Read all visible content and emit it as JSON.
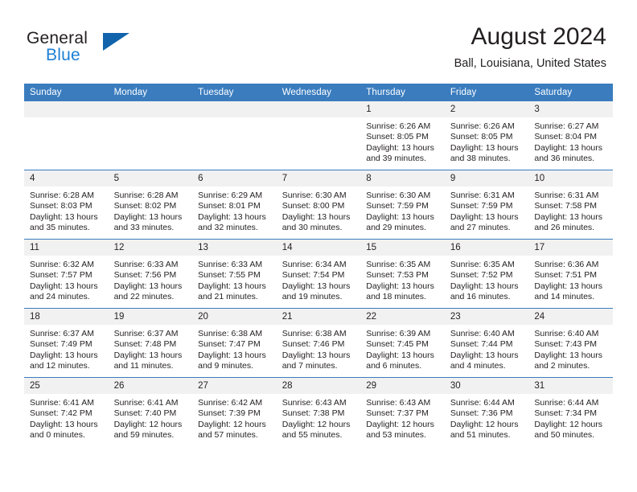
{
  "brand": {
    "name_top": "General",
    "name_bottom": "Blue",
    "triangle_color": "#1163ab",
    "blue_text_color": "#1b7fd4"
  },
  "header": {
    "title": "August 2024",
    "location": "Ball, Louisiana, United States"
  },
  "theme": {
    "header_blue": "#3a7cbe",
    "daynum_bg": "#f1f1f1",
    "text": "#231f20"
  },
  "calendar": {
    "weekday_headers": [
      "Sunday",
      "Monday",
      "Tuesday",
      "Wednesday",
      "Thursday",
      "Friday",
      "Saturday"
    ],
    "labels": {
      "sunrise": "Sunrise:",
      "sunset": "Sunset:",
      "daylight": "Daylight:"
    },
    "weeks": [
      [
        {
          "day": "",
          "blank": true
        },
        {
          "day": "",
          "blank": true
        },
        {
          "day": "",
          "blank": true
        },
        {
          "day": "",
          "blank": true
        },
        {
          "day": "1",
          "l1": "Sunrise: 6:26 AM",
          "l2": "Sunset: 8:05 PM",
          "l3": "Daylight: 13 hours",
          "l4": "and 39 minutes."
        },
        {
          "day": "2",
          "l1": "Sunrise: 6:26 AM",
          "l2": "Sunset: 8:05 PM",
          "l3": "Daylight: 13 hours",
          "l4": "and 38 minutes."
        },
        {
          "day": "3",
          "l1": "Sunrise: 6:27 AM",
          "l2": "Sunset: 8:04 PM",
          "l3": "Daylight: 13 hours",
          "l4": "and 36 minutes."
        }
      ],
      [
        {
          "day": "4",
          "l1": "Sunrise: 6:28 AM",
          "l2": "Sunset: 8:03 PM",
          "l3": "Daylight: 13 hours",
          "l4": "and 35 minutes."
        },
        {
          "day": "5",
          "l1": "Sunrise: 6:28 AM",
          "l2": "Sunset: 8:02 PM",
          "l3": "Daylight: 13 hours",
          "l4": "and 33 minutes."
        },
        {
          "day": "6",
          "l1": "Sunrise: 6:29 AM",
          "l2": "Sunset: 8:01 PM",
          "l3": "Daylight: 13 hours",
          "l4": "and 32 minutes."
        },
        {
          "day": "7",
          "l1": "Sunrise: 6:30 AM",
          "l2": "Sunset: 8:00 PM",
          "l3": "Daylight: 13 hours",
          "l4": "and 30 minutes."
        },
        {
          "day": "8",
          "l1": "Sunrise: 6:30 AM",
          "l2": "Sunset: 7:59 PM",
          "l3": "Daylight: 13 hours",
          "l4": "and 29 minutes."
        },
        {
          "day": "9",
          "l1": "Sunrise: 6:31 AM",
          "l2": "Sunset: 7:59 PM",
          "l3": "Daylight: 13 hours",
          "l4": "and 27 minutes."
        },
        {
          "day": "10",
          "l1": "Sunrise: 6:31 AM",
          "l2": "Sunset: 7:58 PM",
          "l3": "Daylight: 13 hours",
          "l4": "and 26 minutes."
        }
      ],
      [
        {
          "day": "11",
          "l1": "Sunrise: 6:32 AM",
          "l2": "Sunset: 7:57 PM",
          "l3": "Daylight: 13 hours",
          "l4": "and 24 minutes."
        },
        {
          "day": "12",
          "l1": "Sunrise: 6:33 AM",
          "l2": "Sunset: 7:56 PM",
          "l3": "Daylight: 13 hours",
          "l4": "and 22 minutes."
        },
        {
          "day": "13",
          "l1": "Sunrise: 6:33 AM",
          "l2": "Sunset: 7:55 PM",
          "l3": "Daylight: 13 hours",
          "l4": "and 21 minutes."
        },
        {
          "day": "14",
          "l1": "Sunrise: 6:34 AM",
          "l2": "Sunset: 7:54 PM",
          "l3": "Daylight: 13 hours",
          "l4": "and 19 minutes."
        },
        {
          "day": "15",
          "l1": "Sunrise: 6:35 AM",
          "l2": "Sunset: 7:53 PM",
          "l3": "Daylight: 13 hours",
          "l4": "and 18 minutes."
        },
        {
          "day": "16",
          "l1": "Sunrise: 6:35 AM",
          "l2": "Sunset: 7:52 PM",
          "l3": "Daylight: 13 hours",
          "l4": "and 16 minutes."
        },
        {
          "day": "17",
          "l1": "Sunrise: 6:36 AM",
          "l2": "Sunset: 7:51 PM",
          "l3": "Daylight: 13 hours",
          "l4": "and 14 minutes."
        }
      ],
      [
        {
          "day": "18",
          "l1": "Sunrise: 6:37 AM",
          "l2": "Sunset: 7:49 PM",
          "l3": "Daylight: 13 hours",
          "l4": "and 12 minutes."
        },
        {
          "day": "19",
          "l1": "Sunrise: 6:37 AM",
          "l2": "Sunset: 7:48 PM",
          "l3": "Daylight: 13 hours",
          "l4": "and 11 minutes."
        },
        {
          "day": "20",
          "l1": "Sunrise: 6:38 AM",
          "l2": "Sunset: 7:47 PM",
          "l3": "Daylight: 13 hours",
          "l4": "and 9 minutes."
        },
        {
          "day": "21",
          "l1": "Sunrise: 6:38 AM",
          "l2": "Sunset: 7:46 PM",
          "l3": "Daylight: 13 hours",
          "l4": "and 7 minutes."
        },
        {
          "day": "22",
          "l1": "Sunrise: 6:39 AM",
          "l2": "Sunset: 7:45 PM",
          "l3": "Daylight: 13 hours",
          "l4": "and 6 minutes."
        },
        {
          "day": "23",
          "l1": "Sunrise: 6:40 AM",
          "l2": "Sunset: 7:44 PM",
          "l3": "Daylight: 13 hours",
          "l4": "and 4 minutes."
        },
        {
          "day": "24",
          "l1": "Sunrise: 6:40 AM",
          "l2": "Sunset: 7:43 PM",
          "l3": "Daylight: 13 hours",
          "l4": "and 2 minutes."
        }
      ],
      [
        {
          "day": "25",
          "l1": "Sunrise: 6:41 AM",
          "l2": "Sunset: 7:42 PM",
          "l3": "Daylight: 13 hours",
          "l4": "and 0 minutes."
        },
        {
          "day": "26",
          "l1": "Sunrise: 6:41 AM",
          "l2": "Sunset: 7:40 PM",
          "l3": "Daylight: 12 hours",
          "l4": "and 59 minutes."
        },
        {
          "day": "27",
          "l1": "Sunrise: 6:42 AM",
          "l2": "Sunset: 7:39 PM",
          "l3": "Daylight: 12 hours",
          "l4": "and 57 minutes."
        },
        {
          "day": "28",
          "l1": "Sunrise: 6:43 AM",
          "l2": "Sunset: 7:38 PM",
          "l3": "Daylight: 12 hours",
          "l4": "and 55 minutes."
        },
        {
          "day": "29",
          "l1": "Sunrise: 6:43 AM",
          "l2": "Sunset: 7:37 PM",
          "l3": "Daylight: 12 hours",
          "l4": "and 53 minutes."
        },
        {
          "day": "30",
          "l1": "Sunrise: 6:44 AM",
          "l2": "Sunset: 7:36 PM",
          "l3": "Daylight: 12 hours",
          "l4": "and 51 minutes."
        },
        {
          "day": "31",
          "l1": "Sunrise: 6:44 AM",
          "l2": "Sunset: 7:34 PM",
          "l3": "Daylight: 12 hours",
          "l4": "and 50 minutes."
        }
      ]
    ]
  }
}
